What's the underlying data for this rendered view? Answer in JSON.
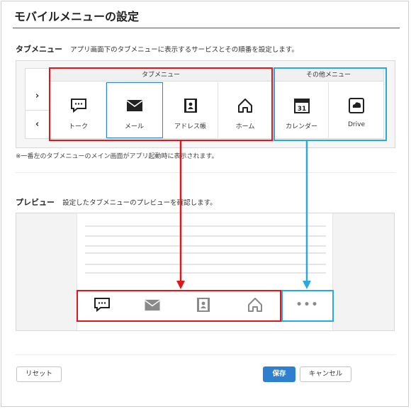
{
  "page": {
    "title": "モバイルメニューの設定"
  },
  "tab_section": {
    "label": "タブメニュー",
    "description": "アプリ画面下のタブメニューに表示するサービスとその順番を設定します。",
    "group_tab_header": "タブメニュー",
    "group_other_header": "その他メニュー",
    "tab_items": [
      {
        "label": "トーク",
        "icon": "chat-icon"
      },
      {
        "label": "メール",
        "icon": "mail-icon"
      },
      {
        "label": "アドレス帳",
        "icon": "address-book-icon"
      },
      {
        "label": "ホーム",
        "icon": "home-icon"
      }
    ],
    "other_items": [
      {
        "label": "カレンダー",
        "icon": "calendar-icon",
        "icon_text": "31"
      },
      {
        "label": "Drive",
        "icon": "drive-icon"
      }
    ],
    "move_right": "›",
    "move_left": "‹",
    "note": "※一番左のタブメニューのメイン画面がアプリ起動時に表示されます。"
  },
  "preview_section": {
    "label": "プレビュー",
    "description": "設定したタブメニューのプレビューを確認します。",
    "more_symbol": "•••"
  },
  "footer": {
    "reset_label": "リセット",
    "save_label": "保存",
    "cancel_label": "キャンセル"
  },
  "colors": {
    "accent_blue": "#2e7fd0",
    "annotation_red": "#e0161b",
    "annotation_cyan": "#2ba9df"
  }
}
